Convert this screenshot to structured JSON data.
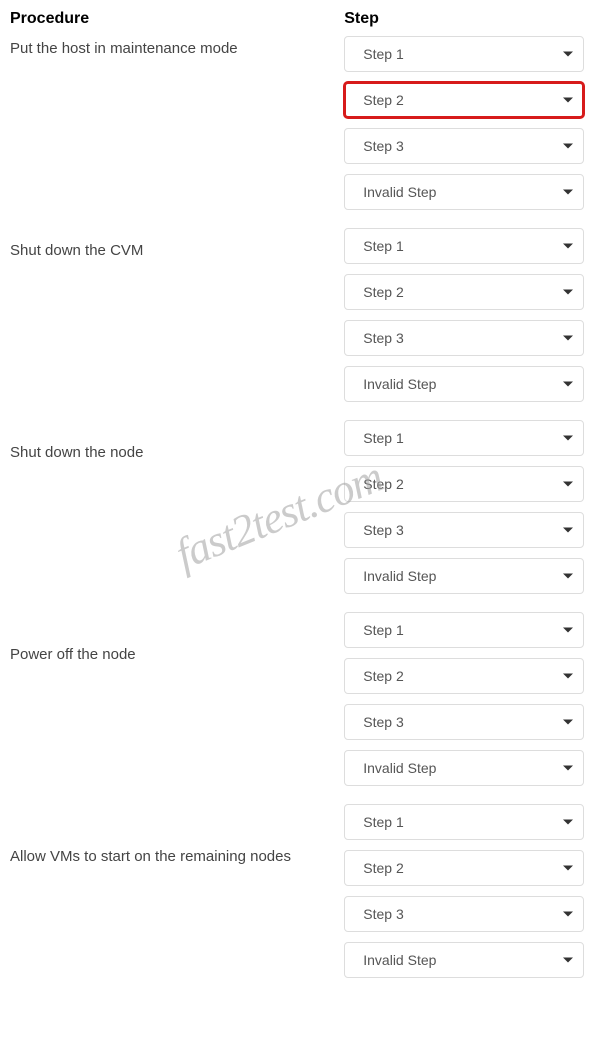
{
  "headers": {
    "procedure": "Procedure",
    "step": "Step"
  },
  "procedures": [
    {
      "label": "Put the host in maintenance mode",
      "steps": [
        "Step 1",
        "Step 2",
        "Step 3",
        "Invalid Step"
      ],
      "highlighted_index": 1
    },
    {
      "label": "Shut down the CVM",
      "steps": [
        "Step 1",
        "Step 2",
        "Step 3",
        "Invalid Step"
      ]
    },
    {
      "label": "Shut down the node",
      "steps": [
        "Step 1",
        "Step 2",
        "Step 3",
        "Invalid Step"
      ]
    },
    {
      "label": "Power off the node",
      "steps": [
        "Step 1",
        "Step 2",
        "Step 3",
        "Invalid Step"
      ]
    },
    {
      "label": "Allow VMs to start on the remaining nodes",
      "steps": [
        "Step 1",
        "Step 2",
        "Step 3",
        "Invalid Step"
      ]
    }
  ],
  "watermark": "fast2test.com"
}
